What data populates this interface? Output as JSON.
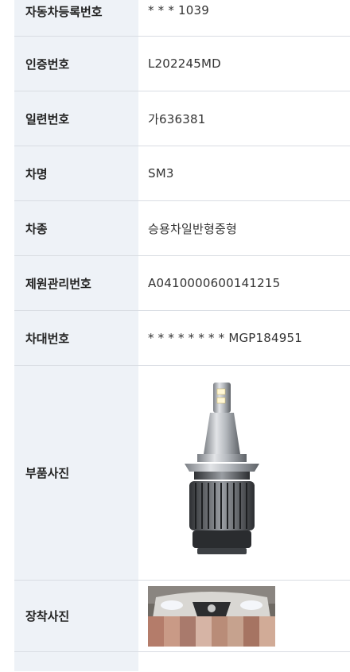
{
  "rows": [
    {
      "label": "자동차등록번호",
      "value": "* * * 1039"
    },
    {
      "label": "인증번호",
      "value": "L202245MD"
    },
    {
      "label": "일련번호",
      "value": "가636381"
    },
    {
      "label": "차명",
      "value": "SM3"
    },
    {
      "label": "차종",
      "value": "승용차일반형중형"
    },
    {
      "label": "제원관리번호",
      "value": "A0410000600141215"
    },
    {
      "label": "차대번호",
      "value": "* * * * * * * * MGP184951"
    }
  ],
  "part_photo": {
    "label": "부품사진",
    "icon": "led-headlight-bulb"
  },
  "mount_photo": {
    "label": "장착사진",
    "icon": "car-front-photo"
  },
  "colors": {
    "header_bg": "#eef2f7",
    "border": "#d9dde3"
  }
}
